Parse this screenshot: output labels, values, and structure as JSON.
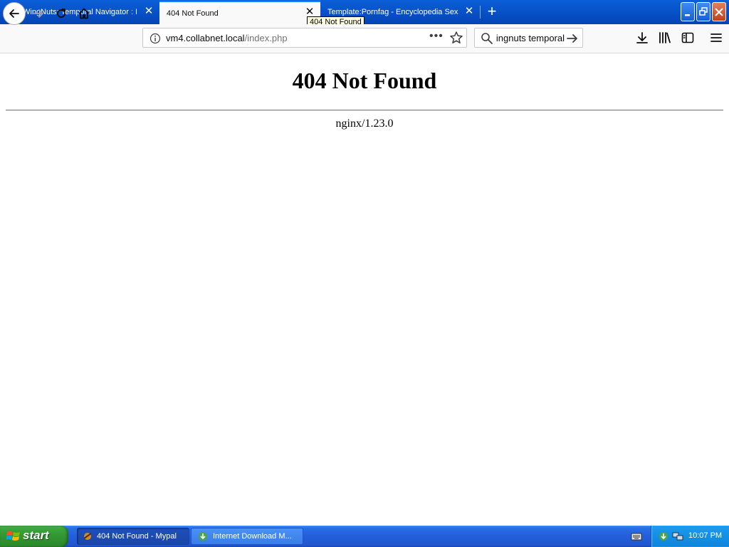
{
  "browser": {
    "tabs": [
      {
        "title": "WingNuts: Temporal Navigator : F",
        "active": false,
        "icon": "museum-icon"
      },
      {
        "title": "404 Not Found",
        "active": true,
        "icon": ""
      },
      {
        "title": "Template:Pornfag - Encyclopedia Sexa",
        "active": false,
        "icon": ""
      }
    ],
    "tooltip": "404 Not Found",
    "url": {
      "host": "vm4.collabnet.local",
      "path": "/index.php"
    },
    "search_text": "wingnuts temporal"
  },
  "page": {
    "heading": "404 Not Found",
    "server": "nginx/1.23.0"
  },
  "taskbar": {
    "start_label": "start",
    "tasks": [
      {
        "label": "404 Not Found - Mypal",
        "active": true
      },
      {
        "label": "Internet Download M...",
        "active": false
      }
    ],
    "clock": "10:07 PM"
  },
  "colors": {
    "tabstrip": "#0a5fd8",
    "active_tab_accent": "#0a84ff",
    "taskbar": "#245edb",
    "start_button": "#39a339",
    "tray": "#138fe6"
  }
}
